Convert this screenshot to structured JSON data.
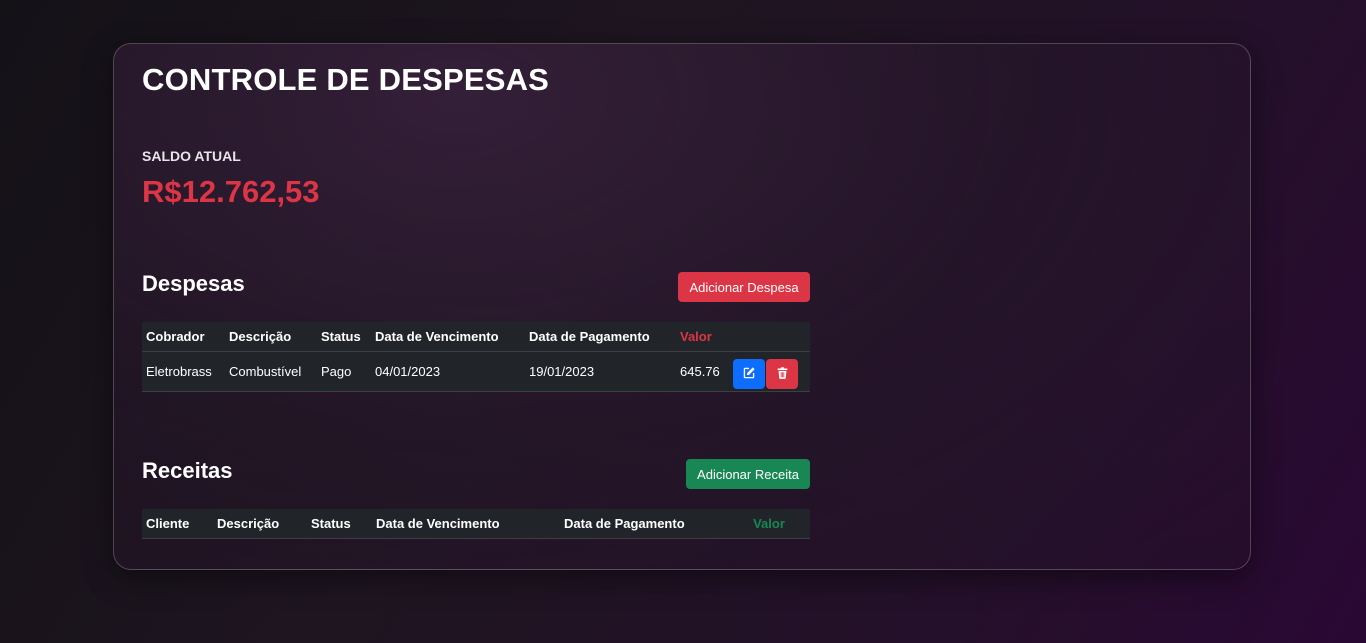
{
  "header": {
    "title": "CONTROLE DE DESPESAS"
  },
  "saldo": {
    "label": "SALDO ATUAL",
    "value": "R$12.762,53",
    "color": "#dc3545"
  },
  "despesas": {
    "title": "Despesas",
    "add_label": "Adicionar Despesa",
    "columns": [
      "Cobrador",
      "Descrição",
      "Status",
      "Data de Vencimento",
      "Data de Pagamento",
      "Valor"
    ],
    "rows": [
      {
        "cobrador": "Eletrobrass",
        "descricao": "Combustível",
        "status": "Pago",
        "vencimento": "04/01/2023",
        "pagamento": "19/01/2023",
        "valor": "645.76",
        "actions": [
          "edit-icon",
          "trash-icon"
        ]
      }
    ]
  },
  "receitas": {
    "title": "Receitas",
    "add_label": "Adicionar Receita",
    "columns": [
      "Cliente",
      "Descrição",
      "Status",
      "Data de Vencimento",
      "Data de Pagamento",
      "Valor"
    ],
    "rows": []
  },
  "colors": {
    "danger": "#dc3545",
    "success": "#198754",
    "primary": "#0d6efd",
    "table_bg": "#212529"
  }
}
